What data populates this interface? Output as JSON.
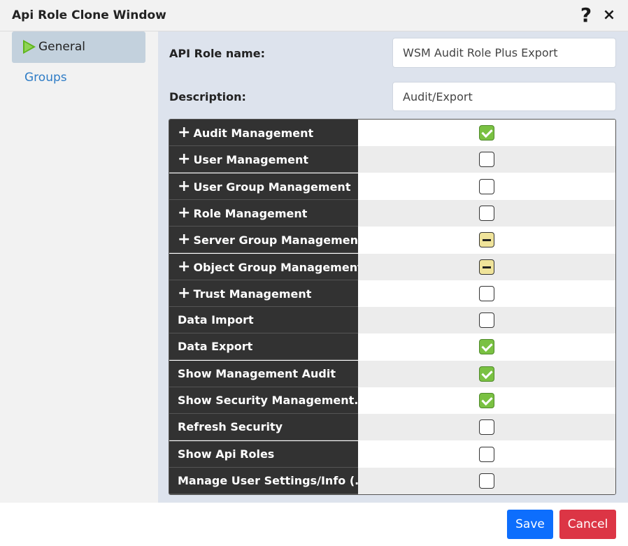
{
  "window": {
    "title": "Api Role Clone Window",
    "help_symbol": "?",
    "close_symbol": "×"
  },
  "sidebar": {
    "items": [
      {
        "label": "General"
      },
      {
        "label": "Groups"
      }
    ]
  },
  "form": {
    "role_name_label": "API Role name:",
    "role_name_value": "WSM Audit Role Plus Export",
    "description_label": "Description:",
    "description_value": "Audit/Export"
  },
  "permissions": [
    {
      "label": "Audit Management",
      "expandable": true,
      "state": "checked"
    },
    {
      "label": "User Management",
      "expandable": true,
      "state": "unchecked"
    },
    {
      "label": "User Group Management",
      "expandable": true,
      "state": "unchecked"
    },
    {
      "label": "Role Management",
      "expandable": true,
      "state": "unchecked"
    },
    {
      "label": "Server Group Management",
      "expandable": true,
      "state": "partial"
    },
    {
      "label": "Object Group Management",
      "expandable": true,
      "state": "partial"
    },
    {
      "label": "Trust Management",
      "expandable": true,
      "state": "unchecked"
    },
    {
      "label": "Data Import",
      "expandable": false,
      "state": "unchecked"
    },
    {
      "label": "Data Export",
      "expandable": false,
      "state": "checked"
    },
    {
      "label": "Show Management Audit",
      "expandable": false,
      "state": "checked"
    },
    {
      "label": "Show Security Management...",
      "expandable": false,
      "state": "checked"
    },
    {
      "label": "Refresh Security",
      "expandable": false,
      "state": "unchecked"
    },
    {
      "label": "Show Api Roles",
      "expandable": false,
      "state": "unchecked"
    },
    {
      "label": "Manage User Settings/Info (...",
      "expandable": false,
      "state": "unchecked"
    }
  ],
  "footer": {
    "save_label": "Save",
    "cancel_label": "Cancel"
  },
  "colors": {
    "accent": "#0d6efd",
    "danger": "#dc3545",
    "checked": "#7ac142",
    "partial": "#efe39a",
    "row_header": "#323232"
  }
}
